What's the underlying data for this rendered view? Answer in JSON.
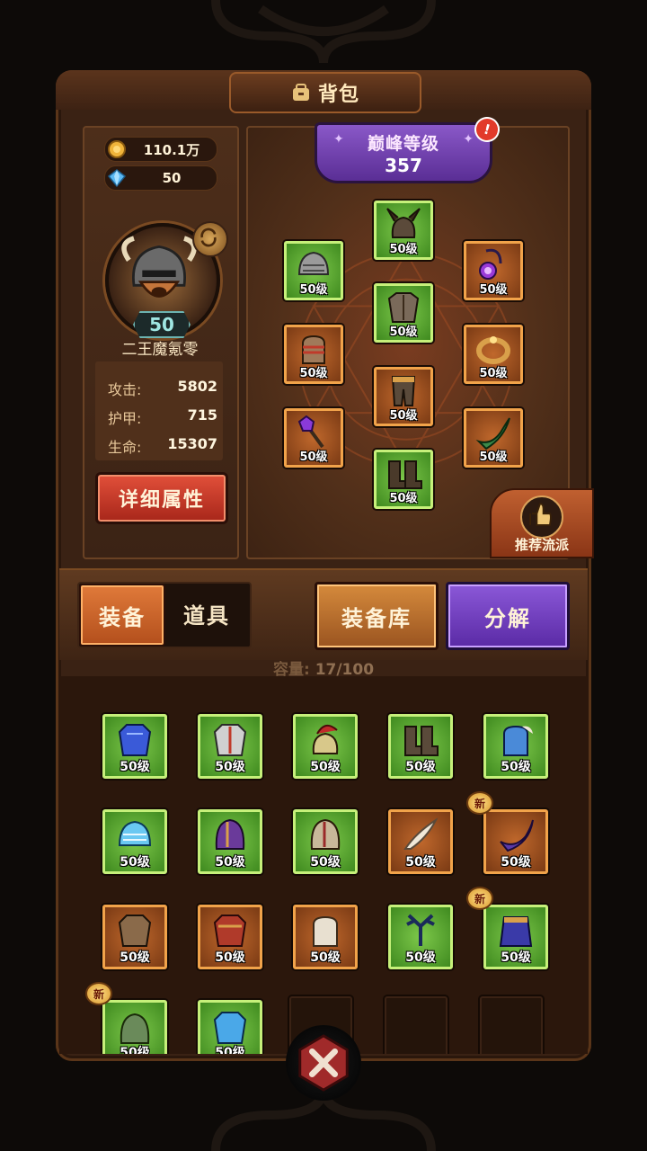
{
  "header": {
    "title": "背包",
    "title_icon": "bag-icon"
  },
  "resources": {
    "gold": "110.1万",
    "gems": "50"
  },
  "player": {
    "level": "50",
    "name": "二王魔氪零",
    "stats": [
      {
        "label": "攻击:",
        "value": "5802"
      },
      {
        "label": "护甲:",
        "value": "715"
      },
      {
        "label": "生命:",
        "value": "15307"
      }
    ],
    "detail_button": "详细属性"
  },
  "peak": {
    "label": "巅峰等级",
    "value": "357",
    "alert": "!"
  },
  "equipped": [
    {
      "level": "50级",
      "rarity": "green",
      "icon": "horned-helmet-icon"
    },
    {
      "level": "50级",
      "rarity": "green",
      "icon": "shoulder-armor-icon"
    },
    {
      "level": "50级",
      "rarity": "orange",
      "icon": "amulet-icon"
    },
    {
      "level": "50级",
      "rarity": "green",
      "icon": "chest-armor-icon"
    },
    {
      "level": "50级",
      "rarity": "orange",
      "icon": "gauntlet-icon"
    },
    {
      "level": "50级",
      "rarity": "orange",
      "icon": "ring-icon"
    },
    {
      "level": "50级",
      "rarity": "orange",
      "icon": "pants-icon"
    },
    {
      "level": "50级",
      "rarity": "orange",
      "icon": "mace-icon"
    },
    {
      "level": "50级",
      "rarity": "orange",
      "icon": "horn-icon"
    },
    {
      "level": "50级",
      "rarity": "green",
      "icon": "boots-icon"
    }
  ],
  "recommend": {
    "label": "推荐流派",
    "icon": "thumbs-up-icon"
  },
  "tabs": {
    "equipment": "装备",
    "items": "道具"
  },
  "buttons": {
    "library": "装备库",
    "decompose": "分解"
  },
  "capacity": {
    "label": "容量:",
    "value": "17/100"
  },
  "inventory": [
    {
      "level": "50级",
      "rarity": "green",
      "icon": "blue-armor-icon",
      "new": false
    },
    {
      "level": "50级",
      "rarity": "green",
      "icon": "silver-chestplate-icon",
      "new": false
    },
    {
      "level": "50级",
      "rarity": "green",
      "icon": "plumed-helmet-icon",
      "new": false
    },
    {
      "level": "50级",
      "rarity": "green",
      "icon": "spiked-boots-icon",
      "new": false
    },
    {
      "level": "50级",
      "rarity": "green",
      "icon": "blue-gauntlet-icon",
      "new": false
    },
    {
      "level": "50级",
      "rarity": "green",
      "icon": "ice-shoulder-icon",
      "new": false
    },
    {
      "level": "50级",
      "rarity": "green",
      "icon": "purple-helmet-icon",
      "new": false
    },
    {
      "level": "50级",
      "rarity": "green",
      "icon": "iron-helmet-icon",
      "new": false
    },
    {
      "level": "50级",
      "rarity": "orange",
      "icon": "feather-quill-icon",
      "new": false
    },
    {
      "level": "50级",
      "rarity": "orange",
      "icon": "purple-horn-icon",
      "new": true
    },
    {
      "level": "50级",
      "rarity": "orange",
      "icon": "bronze-chestplate-icon",
      "new": false
    },
    {
      "level": "50级",
      "rarity": "orange",
      "icon": "red-armor-icon",
      "new": false
    },
    {
      "level": "50级",
      "rarity": "orange",
      "icon": "white-glove-icon",
      "new": false
    },
    {
      "level": "50级",
      "rarity": "green",
      "icon": "dark-antler-icon",
      "new": false
    },
    {
      "level": "50级",
      "rarity": "green",
      "icon": "blue-skirt-icon",
      "new": true
    },
    {
      "level": "50级",
      "rarity": "green",
      "icon": "green-helmet-icon",
      "new": true
    },
    {
      "level": "50级",
      "rarity": "green",
      "icon": "crystal-armor-icon",
      "new": false
    },
    {
      "level": "",
      "rarity": "empty",
      "icon": "",
      "new": false
    },
    {
      "level": "",
      "rarity": "empty",
      "icon": "",
      "new": false
    },
    {
      "level": "",
      "rarity": "empty",
      "icon": "",
      "new": false
    }
  ],
  "new_tag": "新",
  "close_icon": "close-icon"
}
